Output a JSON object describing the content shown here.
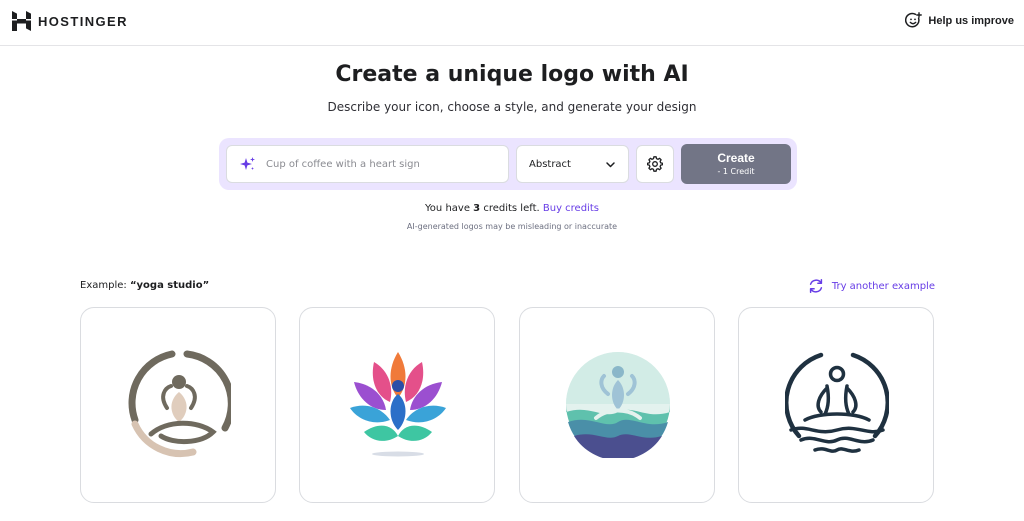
{
  "brand": {
    "name": "HOSTINGER",
    "icon": "hostinger-logo-icon"
  },
  "header": {
    "help_label": "Help us improve",
    "help_icon": "smiley-plus-icon"
  },
  "hero": {
    "title": "Create a unique logo with AI",
    "subtitle": "Describe your icon, choose a style, and generate your design"
  },
  "generator": {
    "prompt_placeholder": "Cup of coffee with a heart sign",
    "prompt_value": "",
    "style_selected": "Abstract",
    "create_label": "Create",
    "create_cost": "- 1 Credit",
    "accent": "#673de6",
    "panel_color": "#ebe4ff",
    "button_color": "#727586"
  },
  "credits": {
    "prefix": "You have",
    "count": "3",
    "suffix": "credits left.",
    "buy_label": "Buy credits",
    "disclaimer": "AI-generated logos may be misleading or inaccurate"
  },
  "example": {
    "label": "Example:",
    "query": "“yoga studio”",
    "try_another_label": "Try another example",
    "cards": [
      {
        "icon": "yoga-pose-circle-logo"
      },
      {
        "icon": "lotus-meditation-logo"
      },
      {
        "icon": "yoga-waves-badge-logo"
      },
      {
        "icon": "meditation-line-logo"
      }
    ]
  }
}
